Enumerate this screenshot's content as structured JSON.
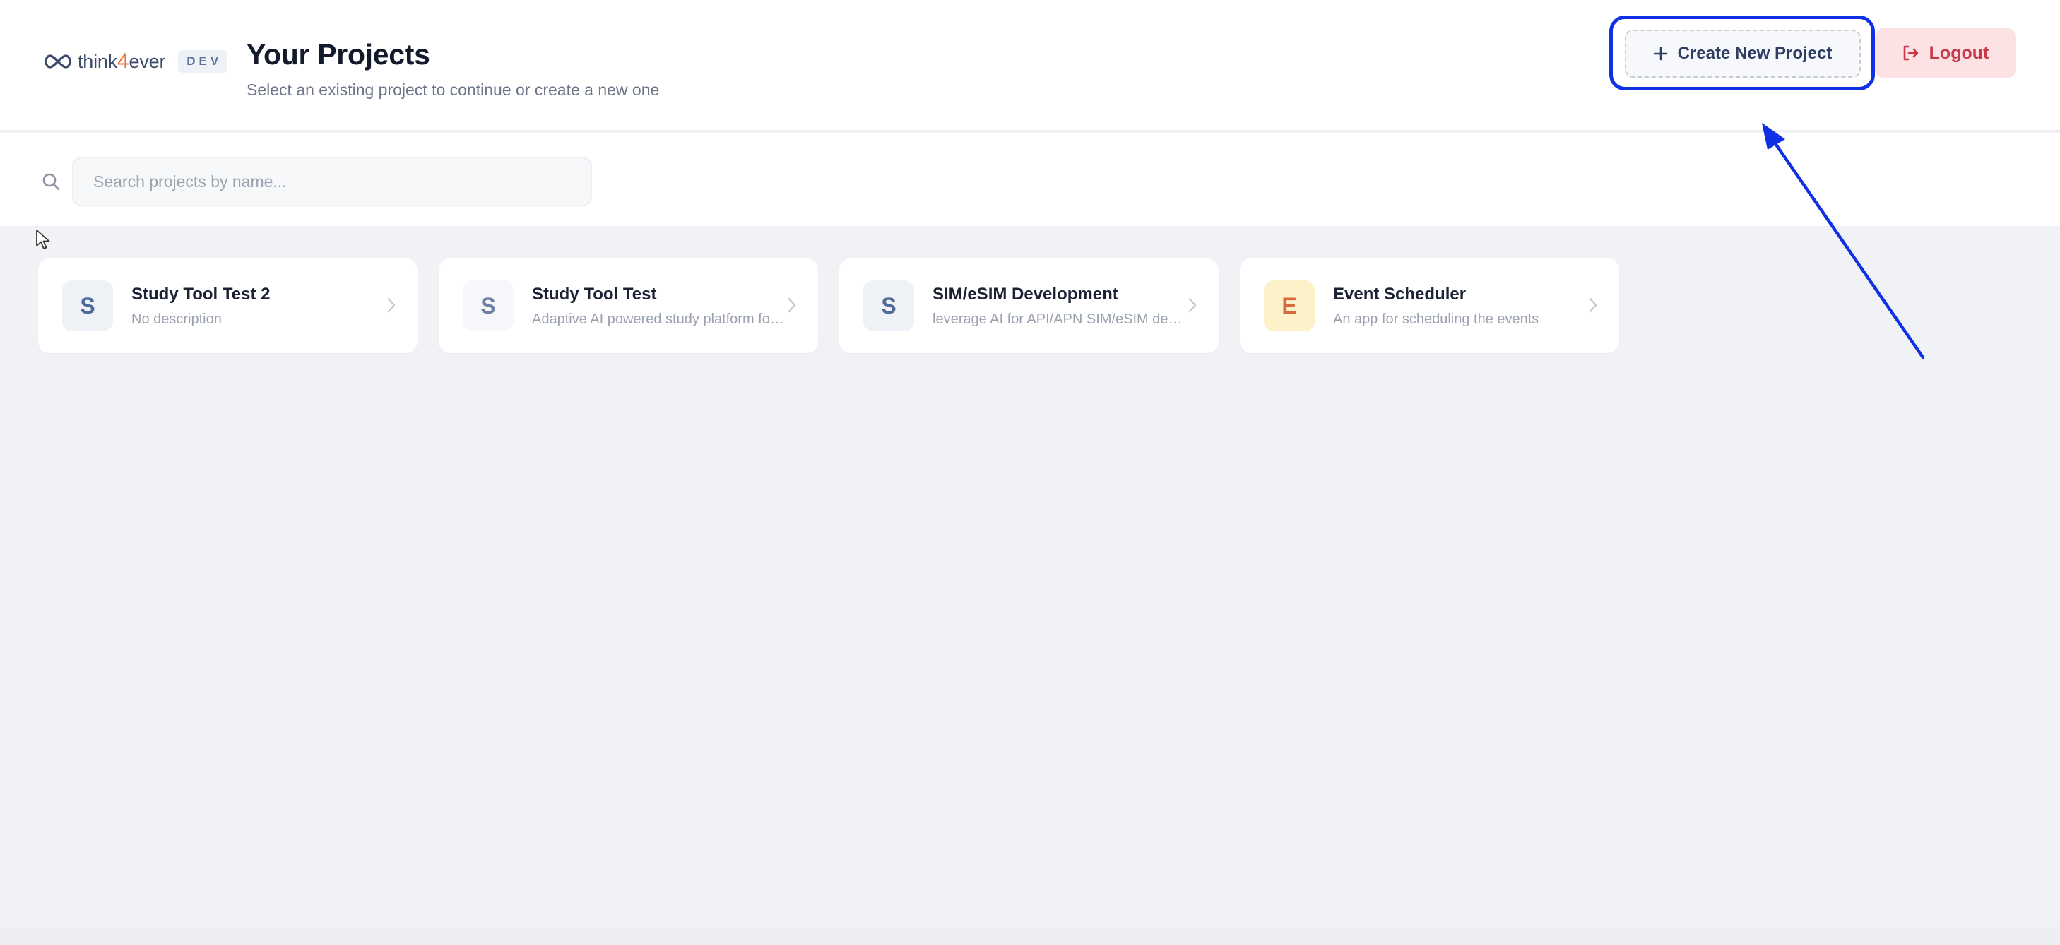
{
  "brand": {
    "name_prefix": "think",
    "name_accent": "4",
    "name_suffix": "ever",
    "env_badge": "DEV",
    "accent_color": "#e9733b"
  },
  "header": {
    "title": "Your Projects",
    "subtitle": "Select an existing project to continue or create a new one",
    "create_label": "Create New Project",
    "create_icon": "plus-icon",
    "logout_label": "Logout",
    "logout_icon": "logout-icon",
    "highlight_color": "#1030e6"
  },
  "search": {
    "placeholder": "Search projects by name...",
    "value": "",
    "icon": "search-icon"
  },
  "projects": [
    {
      "initial": "S",
      "name": "Study Tool Test 2",
      "description": "No description"
    },
    {
      "initial": "S",
      "name": "Study Tool Test",
      "description": "Adaptive AI powered study platform for students and educators"
    },
    {
      "initial": "S",
      "name": "SIM/eSIM Development",
      "description": "leverage AI for API/APN SIM/eSIM development and testing"
    },
    {
      "initial": "E",
      "name": "Event Scheduler",
      "description": "An app for scheduling the events"
    }
  ]
}
